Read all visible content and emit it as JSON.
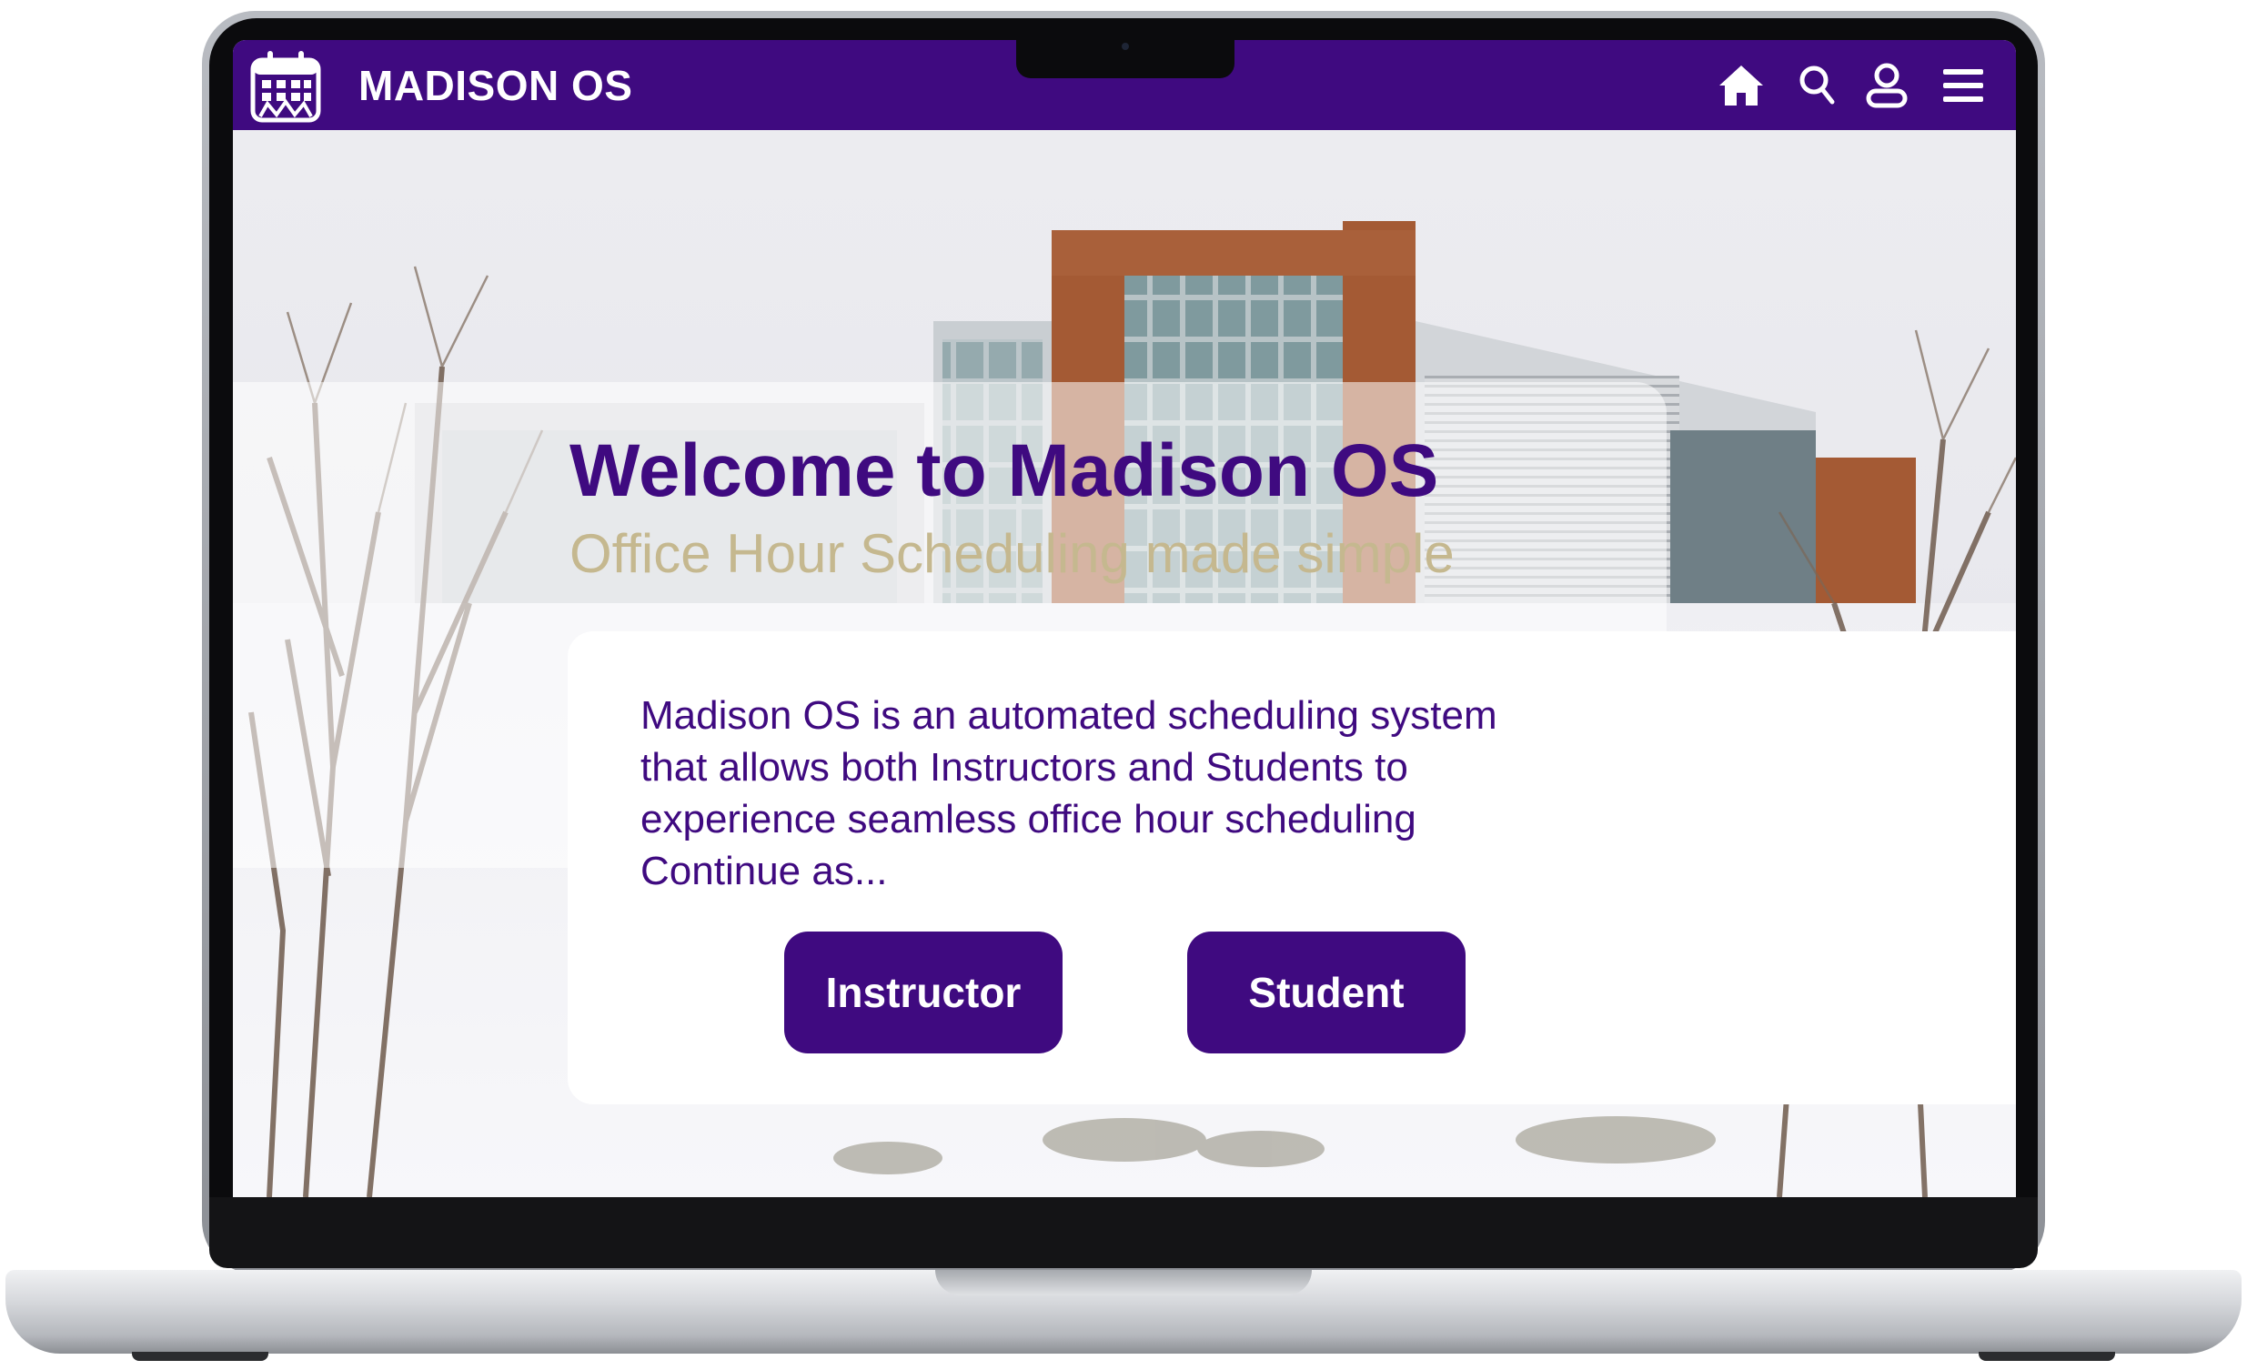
{
  "app": {
    "brand": "MADISON OS",
    "colors": {
      "primary": "#3f0a80",
      "accent_gold": "#c5b88f",
      "card": "#ffffff"
    }
  },
  "navbar": {
    "logo_icon": "calendar-logo-icon",
    "icons": [
      "home-icon",
      "search-icon",
      "user-icon",
      "menu-icon"
    ]
  },
  "hero": {
    "title": "Welcome to Madison OS",
    "subtitle": "Office Hour Scheduling made simple"
  },
  "info": {
    "lines": [
      "Madison OS is an automated scheduling system",
      "that allows both Instructors and Students to",
      "experience seamless office hour scheduling",
      "Continue as..."
    ]
  },
  "actions": {
    "instructor_label": "Instructor",
    "student_label": "Student"
  }
}
